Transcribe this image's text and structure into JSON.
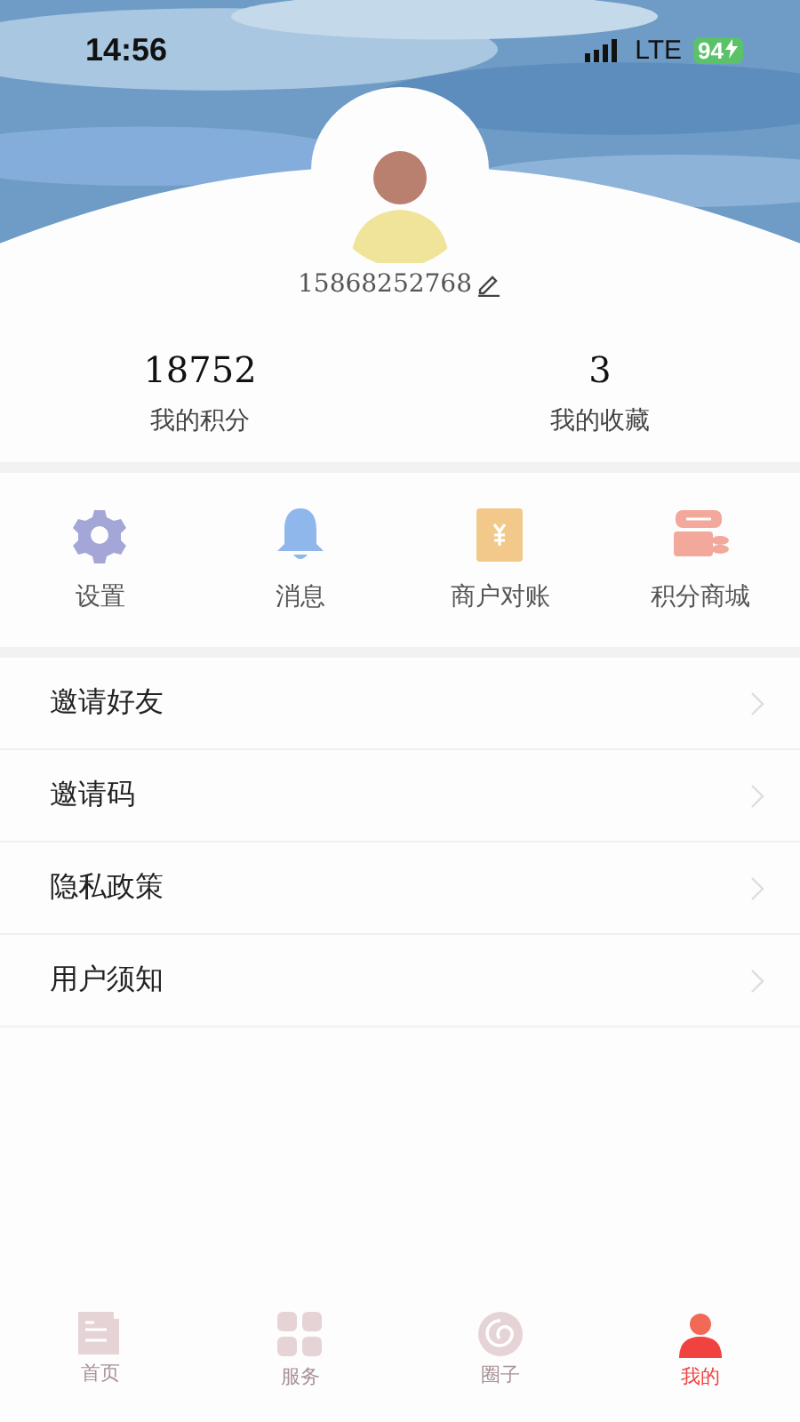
{
  "status_bar": {
    "time": "14:56",
    "network": "LTE",
    "battery": "94",
    "charging": true
  },
  "profile": {
    "phone": "15868252768"
  },
  "stats": [
    {
      "value": "18752",
      "label": "我的积分"
    },
    {
      "value": "3",
      "label": "我的收藏"
    }
  ],
  "shortcuts": [
    {
      "kind": "gear",
      "label": "设置",
      "color": "#a3a6d6"
    },
    {
      "kind": "bell",
      "label": "消息",
      "color": "#8fb7ec"
    },
    {
      "kind": "ledger",
      "label": "商户对账",
      "color": "#f2c98a"
    },
    {
      "kind": "shop",
      "label": "积分商城",
      "color": "#f3a89c"
    }
  ],
  "menu": [
    {
      "label": "邀请好友"
    },
    {
      "label": "邀请码"
    },
    {
      "label": "隐私政策"
    },
    {
      "label": "用户须知"
    }
  ],
  "tabs": [
    {
      "kind": "home",
      "label": "首页",
      "selected": false
    },
    {
      "kind": "grid",
      "label": "服务",
      "selected": false
    },
    {
      "kind": "circle",
      "label": "圈子",
      "selected": false
    },
    {
      "kind": "person",
      "label": "我的",
      "selected": true
    }
  ]
}
